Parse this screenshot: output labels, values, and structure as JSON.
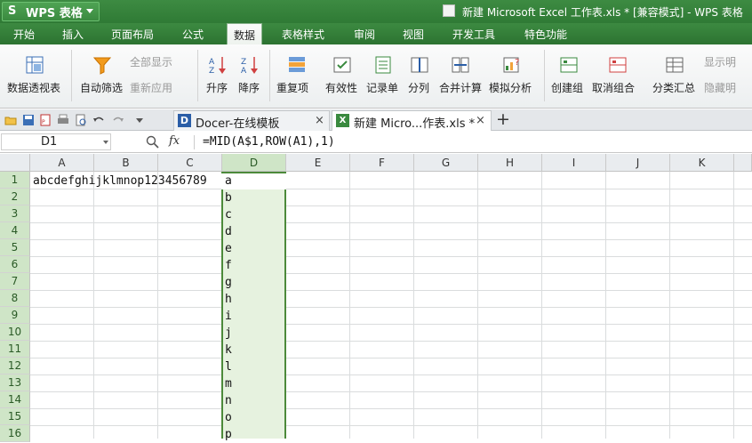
{
  "app": {
    "name": "WPS 表格",
    "logo": "S"
  },
  "window": {
    "title": "新建 Microsoft Excel 工作表.xls * [兼容模式] - WPS 表格"
  },
  "menu": [
    "开始",
    "插入",
    "页面布局",
    "公式",
    "数据",
    "表格样式",
    "审阅",
    "视图",
    "开发工具",
    "特色功能"
  ],
  "menu_active": "数据",
  "ribbon": {
    "pivot": "数据透视表",
    "autofilter": "自动筛选",
    "show_all": "全部显示",
    "reapply": "重新应用",
    "sort_asc": "升序",
    "sort_desc": "降序",
    "duplicates": "重复项",
    "validity": "有效性",
    "record_sheet": "记录单",
    "split_col": "分列",
    "consolidate": "合并计算",
    "what_if": "模拟分析",
    "group": "创建组",
    "ungroup": "取消组合",
    "subtotal": "分类汇总",
    "show_detail": "显示明",
    "hide_detail": "隐藏明"
  },
  "tabs": [
    {
      "label": "Docer-在线模板",
      "close": "×"
    },
    {
      "label": "新建 Micro...作表.xls *",
      "close": "×"
    }
  ],
  "new_tab": "+",
  "formula_bar": {
    "cell_ref": "D1",
    "fx": "fx",
    "formula": "=MID(A$1,ROW(A1),1)"
  },
  "columns": [
    "A",
    "B",
    "C",
    "D",
    "E",
    "F",
    "G",
    "H",
    "I",
    "J",
    "K"
  ],
  "selected_column": "D",
  "rows": [
    "1",
    "2",
    "3",
    "4",
    "5",
    "6",
    "7",
    "8",
    "9",
    "10",
    "11",
    "12",
    "13",
    "14",
    "15",
    "16"
  ],
  "cells": {
    "A1": "abcdefghijklmnop123456789",
    "D": [
      "a",
      "b",
      "c",
      "d",
      "e",
      "f",
      "g",
      "h",
      "i",
      "j",
      "k",
      "l",
      "m",
      "n",
      "o",
      "p"
    ]
  },
  "colors": {
    "accent": "#3a8a3f",
    "selection": "#4c8a3a",
    "selection_fill": "#e6f2df"
  }
}
